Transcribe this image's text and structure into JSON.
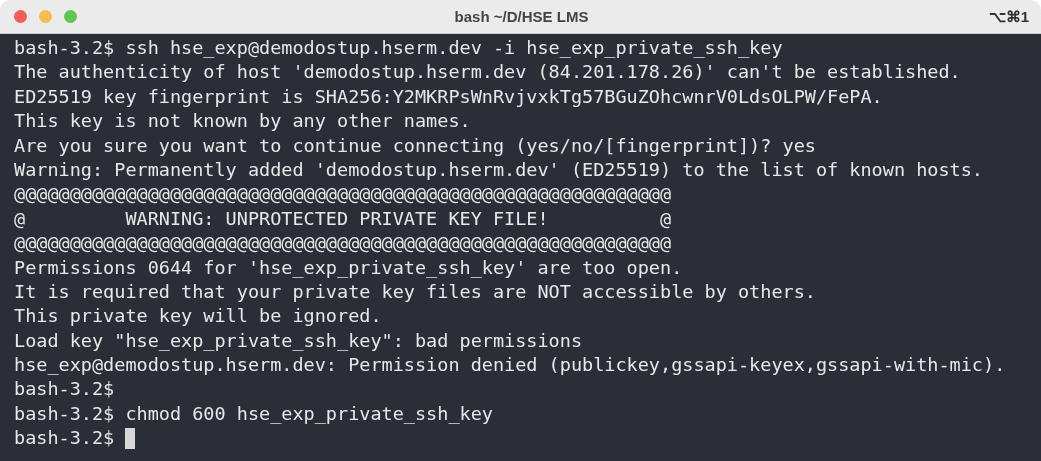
{
  "window": {
    "title": "bash ~/D/HSE LMS",
    "shortcut": "⌥⌘1"
  },
  "terminal": {
    "lines": [
      "bash-3.2$ ssh hse_exp@demodostup.hserm.dev -i hse_exp_private_ssh_key",
      "The authenticity of host 'demodostup.hserm.dev (84.201.178.26)' can't be established.",
      "ED25519 key fingerprint is SHA256:Y2MKRPsWnRvjvxkTg57BGuZOhcwnrV0LdsOLPW/FePA.",
      "This key is not known by any other names.",
      "Are you sure you want to continue connecting (yes/no/[fingerprint])? yes",
      "Warning: Permanently added 'demodostup.hserm.dev' (ED25519) to the list of known hosts.",
      "@@@@@@@@@@@@@@@@@@@@@@@@@@@@@@@@@@@@@@@@@@@@@@@@@@@@@@@@@@@",
      "@         WARNING: UNPROTECTED PRIVATE KEY FILE!          @",
      "@@@@@@@@@@@@@@@@@@@@@@@@@@@@@@@@@@@@@@@@@@@@@@@@@@@@@@@@@@@",
      "Permissions 0644 for 'hse_exp_private_ssh_key' are too open.",
      "It is required that your private key files are NOT accessible by others.",
      "This private key will be ignored.",
      "Load key \"hse_exp_private_ssh_key\": bad permissions",
      "hse_exp@demodostup.hserm.dev: Permission denied (publickey,gssapi-keyex,gssapi-with-mic).",
      "bash-3.2$",
      "bash-3.2$ chmod 600 hse_exp_private_ssh_key",
      "bash-3.2$"
    ]
  }
}
